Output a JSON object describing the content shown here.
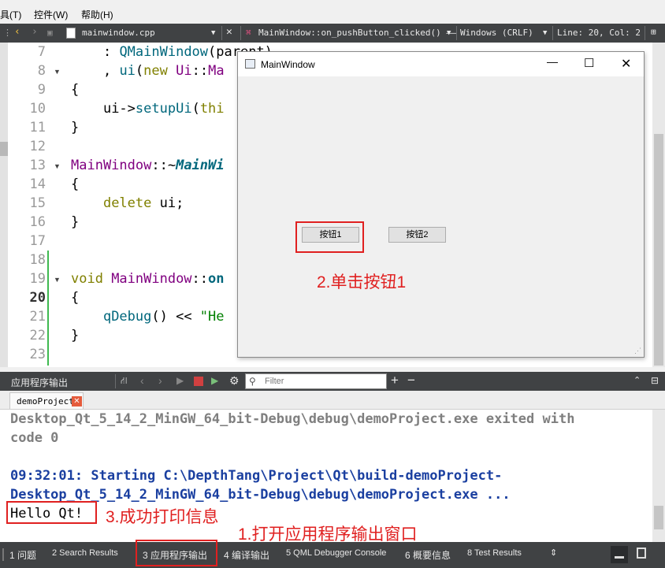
{
  "menubar": {
    "items": [
      "具(T)",
      "控件(W)",
      "帮助(H)"
    ]
  },
  "editor_toolbar": {
    "file": "mainwindow.cpp",
    "function": "MainWindow::on_pushButton_clicked() ——",
    "encoding": "Windows (CRLF)",
    "position": "Line: 20, Col: 2"
  },
  "editor": {
    "lines": [
      {
        "num": "7"
      },
      {
        "num": "8"
      },
      {
        "num": "9"
      },
      {
        "num": "10"
      },
      {
        "num": "11"
      },
      {
        "num": "12"
      },
      {
        "num": "13"
      },
      {
        "num": "14"
      },
      {
        "num": "15"
      },
      {
        "num": "16"
      },
      {
        "num": "17"
      },
      {
        "num": "18"
      },
      {
        "num": "19"
      },
      {
        "num": "20"
      },
      {
        "num": "21"
      },
      {
        "num": "22"
      },
      {
        "num": "23"
      }
    ],
    "code": {
      "l7_colon": ": ",
      "l7_fn": "QMainWindow",
      "l7_rest": "(parent)",
      "l8_a": ", ",
      "l8_ui": "ui",
      "l8_p": "(",
      "l8_new": "new ",
      "l8_ns": "Ui",
      "l8_sep": "::",
      "l8_cls": "Ma",
      "l9": "{",
      "l10_a": "ui->",
      "l10_fn": "setupUi",
      "l10_b": "(",
      "l10_this": "thi",
      "l11": "}",
      "l13_cls": "MainWindow",
      "l13_sep": "::~",
      "l13_fn": "MainWi",
      "l14": "{",
      "l15_kw": "delete",
      "l15_rest": " ui;",
      "l16": "}",
      "l19_kw": "void ",
      "l19_cls": "MainWindow",
      "l19_sep": "::",
      "l19_fn": "on",
      "l20": "{",
      "l21_fn": "qDebug",
      "l21_a": "() << ",
      "l21_str": "\"He",
      "l22": "}"
    }
  },
  "main_window": {
    "title": "MainWindow",
    "button1": "按钮1",
    "button2": "按钮2",
    "annotation2": "2.单击按钮1"
  },
  "output_pane": {
    "title": "应用程序输出",
    "filter_placeholder": "Filter",
    "tab": "demoProject",
    "lines": [
      "Desktop_Qt_5_14_2_MinGW_64_bit-Debug\\debug\\demoProject.exe exited with",
      "code 0",
      "09:32:01: Starting C:\\DepthTang\\Project\\Qt\\build-demoProject-",
      "Desktop_Qt_5_14_2_MinGW_64_bit-Debug\\debug\\demoProject.exe ...",
      "Hello Qt!"
    ],
    "annotation3": "3.成功打印信息"
  },
  "annotation1": "1.打开应用程序输出窗口",
  "status_bar": {
    "items": [
      "1 问题",
      "2 Search Results",
      "3 应用程序输出",
      "4 编译输出",
      "5 QML Debugger Console",
      "6 概要信息",
      "8 Test Results"
    ]
  },
  "colors": {
    "annotation": "#e02020",
    "exited_text": "#7f7f7f",
    "starting_text": "#1a3fa0",
    "dark_toolbar": "#404244"
  }
}
